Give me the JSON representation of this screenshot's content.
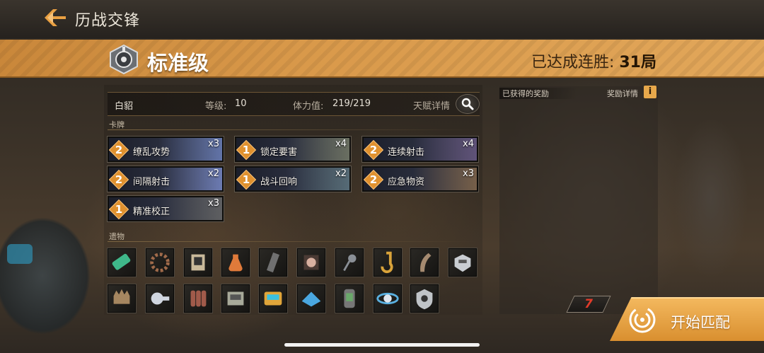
{
  "header": {
    "title": "历战交锋"
  },
  "banner": {
    "tier": "标准级",
    "streak_label": "已达成连胜:",
    "streak_value": "31局"
  },
  "player": {
    "name": "白貂",
    "level_label": "等级:",
    "level_value": "10",
    "stamina_label": "体力值:",
    "stamina_value": "219/219",
    "talent_label": "天赋详情"
  },
  "cards_section": {
    "label": "卡牌",
    "cards": [
      {
        "cost": "2",
        "name": "缭乱攻势",
        "qty": "x3",
        "art_color": "#6f86c9"
      },
      {
        "cost": "1",
        "name": "锁定要害",
        "qty": "x4",
        "art_color": "#7a7f6a"
      },
      {
        "cost": "2",
        "name": "连续射击",
        "qty": "x4",
        "art_color": "#6c5a8a"
      },
      {
        "cost": "2",
        "name": "间隔射击",
        "qty": "x2",
        "art_color": "#7c8fd6"
      },
      {
        "cost": "1",
        "name": "战斗回响",
        "qty": "x2",
        "art_color": "#5f7a86"
      },
      {
        "cost": "2",
        "name": "应急物资",
        "qty": "x3",
        "art_color": "#8a6a4a"
      },
      {
        "cost": "1",
        "name": "精准校正",
        "qty": "x3",
        "art_color": "#6a6a6a"
      }
    ]
  },
  "relics_section": {
    "label": "遗物",
    "relics": [
      {
        "icon": "green-vial-icon",
        "color": "#3fb88a"
      },
      {
        "icon": "gear-wreath-icon",
        "color": "#a06a4a"
      },
      {
        "icon": "portrait-icon",
        "color": "#c9b99a"
      },
      {
        "icon": "potion-flask-icon",
        "color": "#e07a3a"
      },
      {
        "icon": "blade-strip-icon",
        "color": "#707070"
      },
      {
        "icon": "orb-device-icon",
        "color": "#d8b0a0"
      },
      {
        "icon": "scanner-icon",
        "color": "#8a8f96"
      },
      {
        "icon": "golden-hook-icon",
        "color": "#d9a33a"
      },
      {
        "icon": "horn-icon",
        "color": "#a58a70"
      },
      {
        "icon": "mech-helmet-icon",
        "color": "#c9cdd2"
      },
      {
        "icon": "spiked-mask-icon",
        "color": "#a58660"
      },
      {
        "icon": "plasma-gun-icon",
        "color": "#d0d6e0"
      },
      {
        "icon": "ammo-shells-icon",
        "color": "#a05a4a"
      },
      {
        "icon": "circuit-board-icon",
        "color": "#a8aa9a"
      },
      {
        "icon": "data-tablet-icon",
        "color": "#e0a53a"
      },
      {
        "icon": "ice-crystal-icon",
        "color": "#4aa7e0"
      },
      {
        "icon": "canister-icon",
        "color": "#6aa86a"
      },
      {
        "icon": "orbit-core-icon",
        "color": "#5ab0e0"
      },
      {
        "icon": "shield-emblem-icon",
        "color": "#c0c4c8"
      }
    ]
  },
  "rewards": {
    "title": "已获得的奖励",
    "detail_label": "奖励详情",
    "info_glyph": "i"
  },
  "footer": {
    "counter": "7",
    "match_label": "开始匹配"
  },
  "colors": {
    "accent": "#d9994a",
    "cost_badge": "#e0912f",
    "counter": "#e23b2a"
  }
}
